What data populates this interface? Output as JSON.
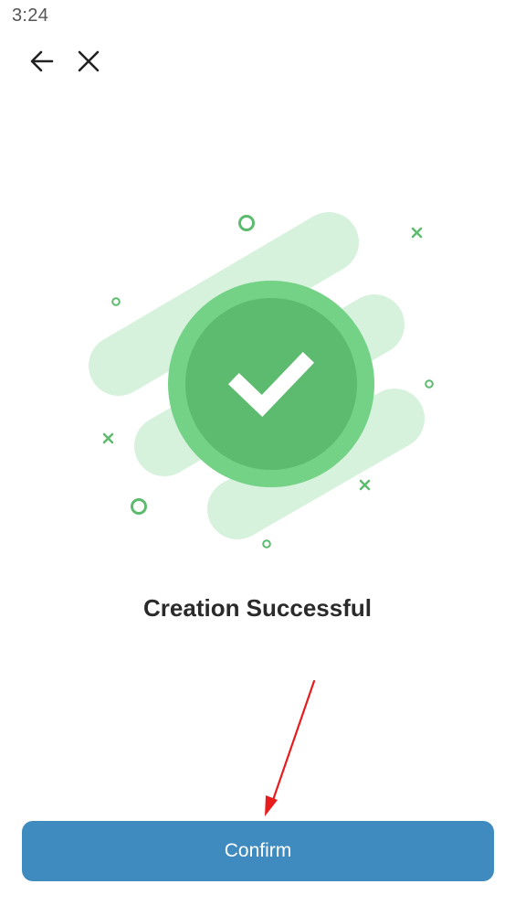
{
  "status_bar": {
    "time": "3:24"
  },
  "nav": {
    "back_icon": "arrow-left-icon",
    "close_icon": "close-icon"
  },
  "illustration": {
    "icon": "success-check-icon",
    "colors": {
      "primary": "#5cbb6e",
      "ring": "#74d286",
      "stripe": "#d6f2dc",
      "accent": "#5cbb6e"
    }
  },
  "message": {
    "title": "Creation Successful"
  },
  "actions": {
    "confirm_label": "Confirm",
    "confirm_color": "#3f8bc0"
  },
  "annotation": {
    "arrow_color": "#e81c1c"
  }
}
